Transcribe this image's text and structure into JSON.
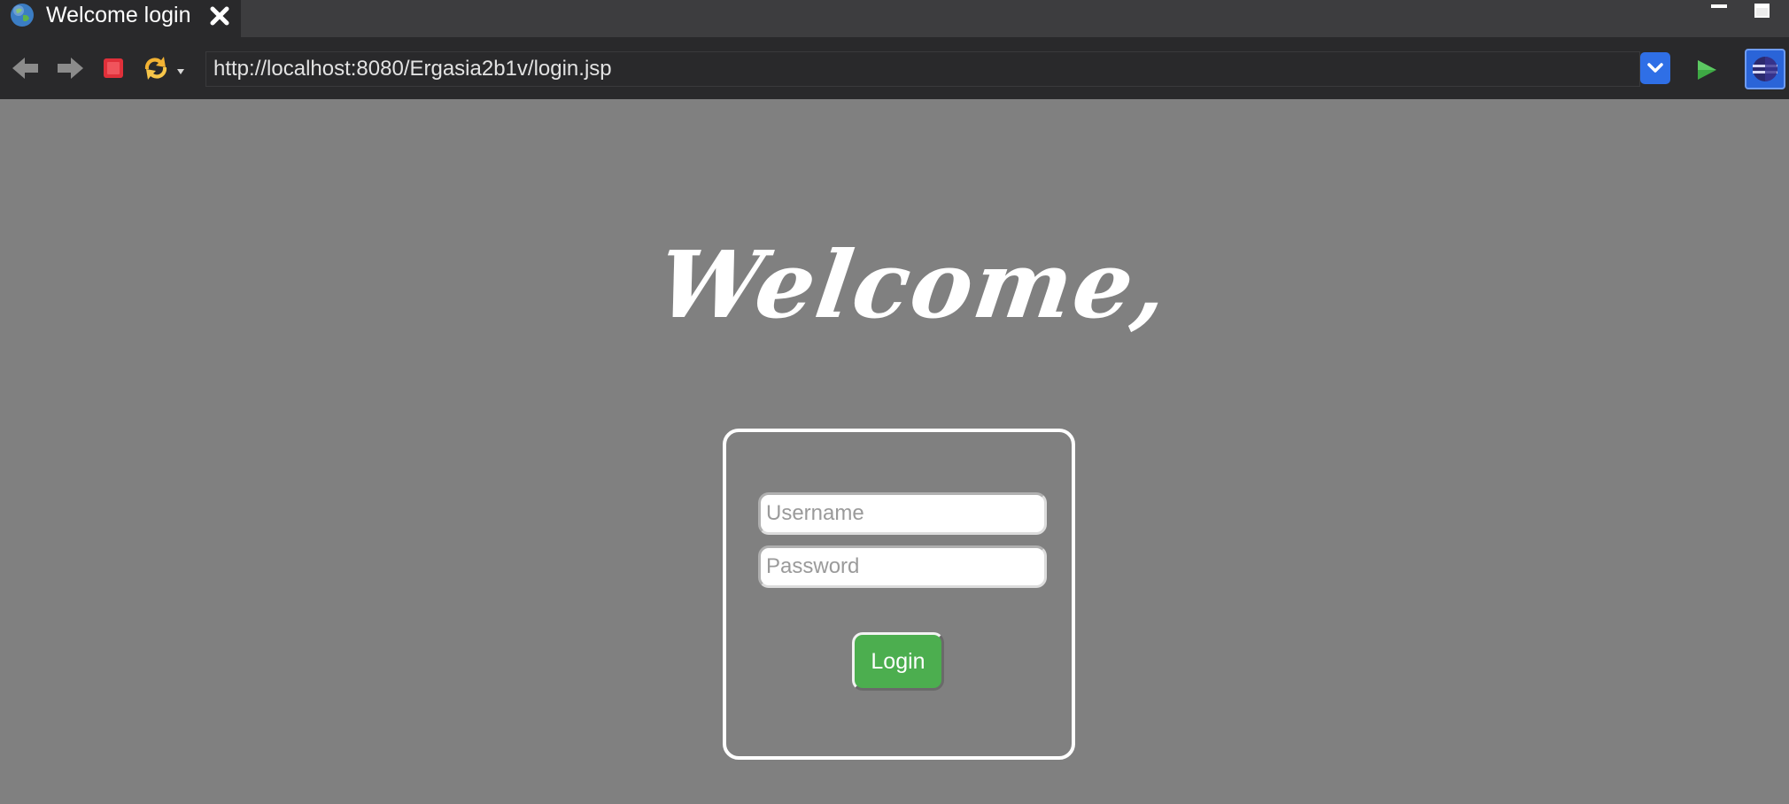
{
  "window": {
    "tab_title": "Welcome login",
    "tab_icon": "globe-icon",
    "controls": [
      "minimize-icon",
      "maximize-icon"
    ]
  },
  "toolbar": {
    "buttons": [
      "back-arrow-icon",
      "forward-arrow-icon",
      "stop-icon",
      "refresh-icon",
      "go-icon",
      "eclipse-icon"
    ],
    "url": "http://localhost:8080/Ergasia2b1v/login.jsp"
  },
  "page": {
    "heading": "Welcome,",
    "username_placeholder": "Username",
    "password_placeholder": "Password",
    "login_label": "Login"
  },
  "colors": {
    "page_background": "#808080",
    "chrome_dark": "#29292b",
    "login_button": "#4cae4f",
    "url_dropdown": "#2f6fe6",
    "stop_red": "#e0303a"
  }
}
